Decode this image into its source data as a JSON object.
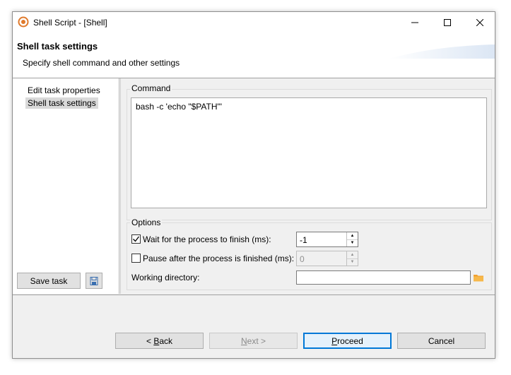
{
  "window": {
    "title": "Shell Script - [Shell]",
    "icon": "app-logo-icon",
    "controls": {
      "minimize": "minimize-icon",
      "maximize": "maximize-icon",
      "close": "close-icon"
    }
  },
  "header": {
    "title": "Shell task settings",
    "subtitle": "Specify shell command and other settings"
  },
  "nav": {
    "items": [
      {
        "label": "Edit task properties",
        "selected": false
      },
      {
        "label": "Shell task settings",
        "selected": true
      }
    ],
    "save_label": "Save task",
    "save_icon": "save-icon"
  },
  "command": {
    "group_label": "Command",
    "value": "bash -c 'echo \"$PATH\"'"
  },
  "options": {
    "group_label": "Options",
    "wait": {
      "label": "Wait for the process to finish (ms):",
      "checked": true,
      "value": "-1"
    },
    "pause": {
      "label": "Pause after the process is finished (ms):",
      "checked": false,
      "value": "0"
    },
    "workdir": {
      "label": "Working directory:",
      "value": "",
      "icon": "folder-icon"
    }
  },
  "buttons": {
    "back_prefix": "< ",
    "back_key": "B",
    "back_rest": "ack",
    "next_key": "N",
    "next_rest": "ext >",
    "proceed_key": "P",
    "proceed_rest": "roceed",
    "cancel": "Cancel"
  },
  "colors": {
    "accent": "#0078d7",
    "folder": "#f0a030"
  }
}
